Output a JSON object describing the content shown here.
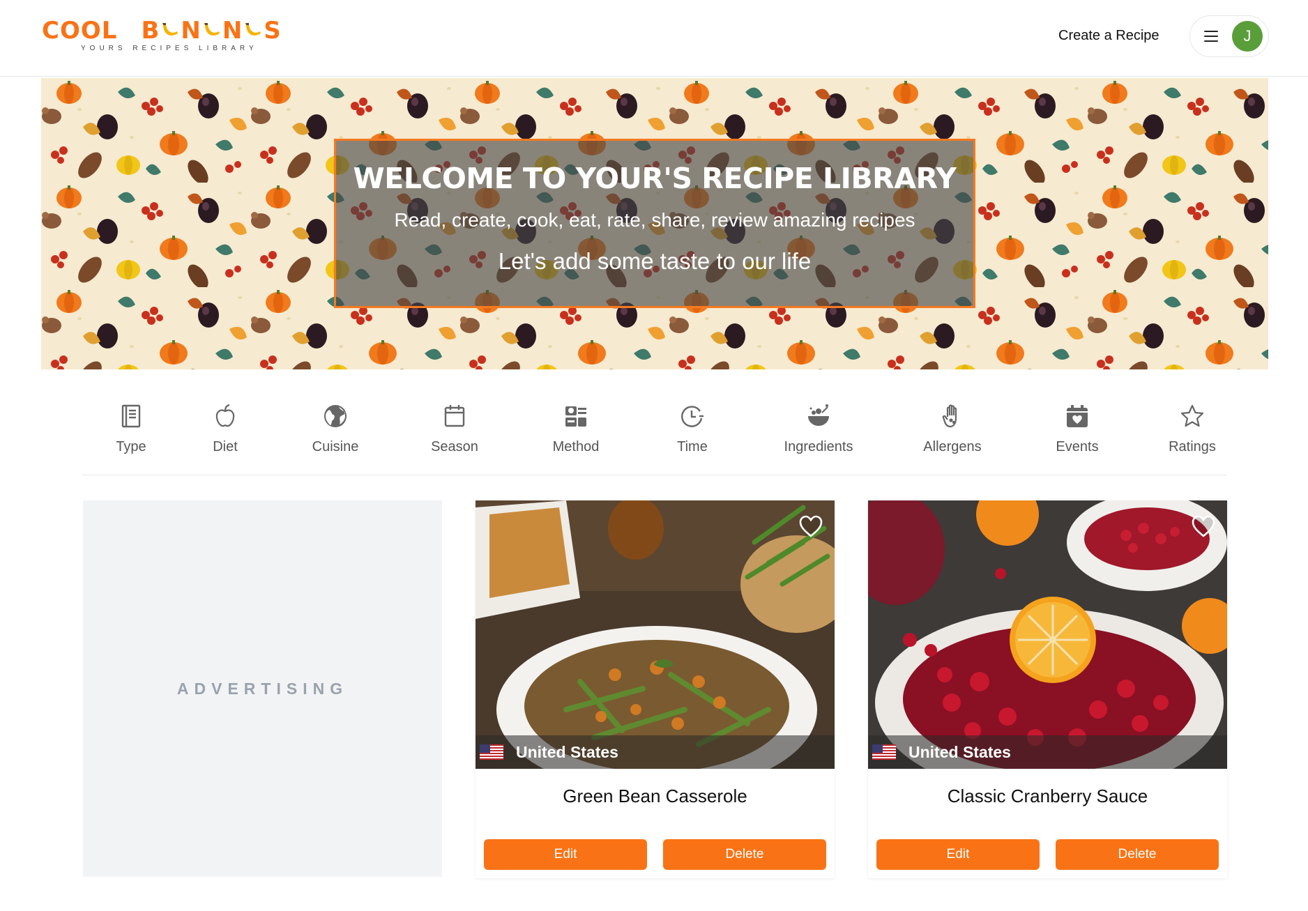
{
  "header": {
    "logo_word1": "COOL",
    "logo_word2_letters": [
      "B",
      "N",
      "N",
      "S"
    ],
    "logo_tagline": "YOURS RECIPES LIBRARY",
    "create_recipe_label": "Create a Recipe",
    "avatar_initial": "J",
    "avatar_color": "#5a9e3a",
    "brand_color": "#f97316"
  },
  "hero": {
    "title": "WELCOME TO YOUR'S RECIPE LIBRARY",
    "subtitle": "Read, create, cook, eat, rate, share, review amazing recipes",
    "tagline": "Let's add some taste to our life"
  },
  "categories": [
    {
      "label": "Type",
      "icon": "document-icon"
    },
    {
      "label": "Diet",
      "icon": "apple-icon"
    },
    {
      "label": "Cuisine",
      "icon": "globe-icon"
    },
    {
      "label": "Season",
      "icon": "calendar-icon"
    },
    {
      "label": "Method",
      "icon": "method-icon"
    },
    {
      "label": "Time",
      "icon": "clock-icon"
    },
    {
      "label": "Ingredients",
      "icon": "bowl-icon"
    },
    {
      "label": "Allergens",
      "icon": "hand-icon"
    },
    {
      "label": "Events",
      "icon": "calendar-heart-icon"
    },
    {
      "label": "Ratings",
      "icon": "star-icon"
    }
  ],
  "advertising": {
    "label": "ADVERTISING"
  },
  "recipes": [
    {
      "title": "Green Bean Casserole",
      "country": "United States",
      "edit_label": "Edit",
      "delete_label": "Delete",
      "image": "green-bean-casserole-photo"
    },
    {
      "title": "Classic Cranberry Sauce",
      "country": "United States",
      "edit_label": "Edit",
      "delete_label": "Delete",
      "image": "cranberry-sauce-photo"
    }
  ]
}
